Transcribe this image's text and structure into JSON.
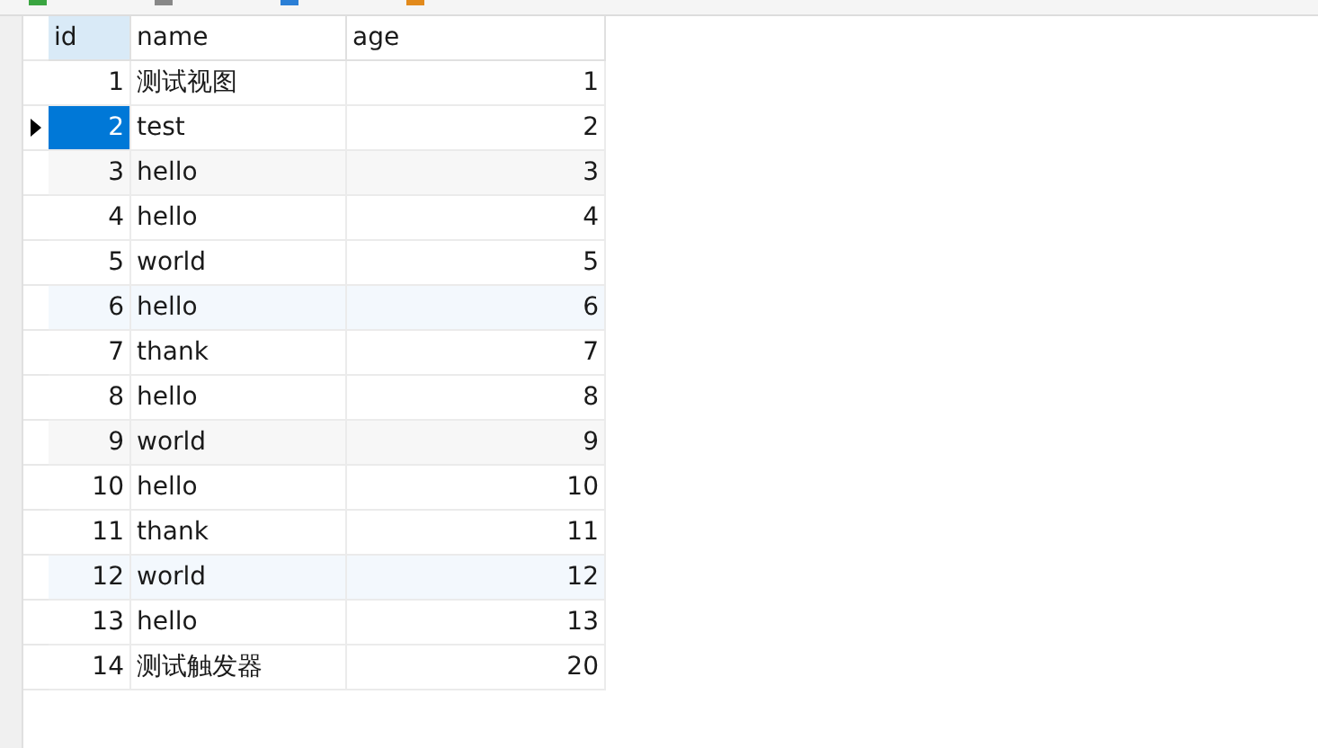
{
  "table": {
    "columns": [
      {
        "label": "id",
        "selected": true
      },
      {
        "label": "name",
        "selected": false
      },
      {
        "label": "age",
        "selected": false
      }
    ],
    "rows": [
      {
        "id": "1",
        "name": "测试视图",
        "age": "1",
        "selected": false
      },
      {
        "id": "2",
        "name": "test",
        "age": "2",
        "selected": true
      },
      {
        "id": "3",
        "name": "hello",
        "age": "3",
        "selected": false,
        "color": "#f7f7f7"
      },
      {
        "id": "4",
        "name": "hello",
        "age": "4",
        "selected": false
      },
      {
        "id": "5",
        "name": "world",
        "age": "5",
        "selected": false
      },
      {
        "id": "6",
        "name": "hello",
        "age": "6",
        "selected": false,
        "color": "#f3f8fd"
      },
      {
        "id": "7",
        "name": "thank",
        "age": "7",
        "selected": false
      },
      {
        "id": "8",
        "name": "hello",
        "age": "8",
        "selected": false
      },
      {
        "id": "9",
        "name": "world",
        "age": "9",
        "selected": false,
        "color": "#f7f7f7"
      },
      {
        "id": "10",
        "name": "hello",
        "age": "10",
        "selected": false
      },
      {
        "id": "11",
        "name": "thank",
        "age": "11",
        "selected": false
      },
      {
        "id": "12",
        "name": "world",
        "age": "12",
        "selected": false,
        "color": "#f3f8fd"
      },
      {
        "id": "13",
        "name": "hello",
        "age": "13",
        "selected": false
      },
      {
        "id": "14",
        "name": "测试触发器",
        "age": "20",
        "selected": false
      }
    ]
  }
}
